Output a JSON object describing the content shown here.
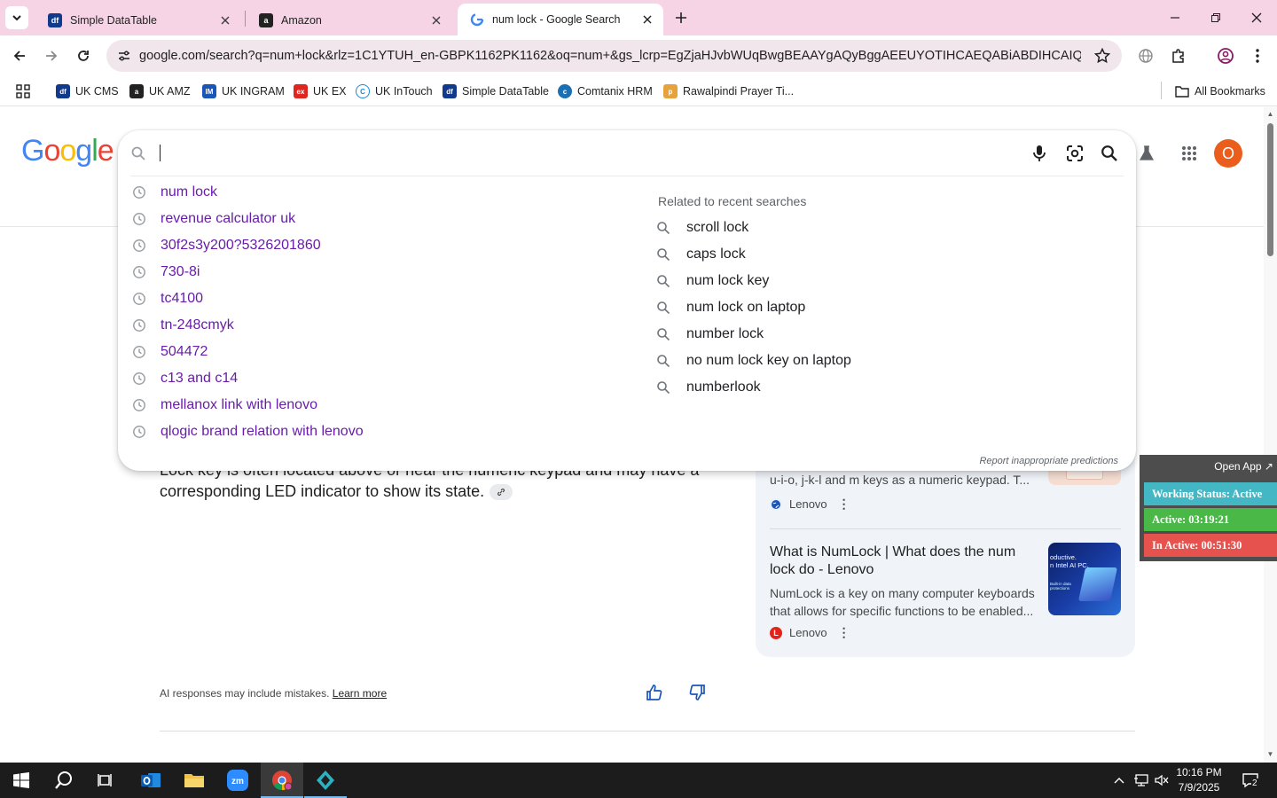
{
  "browser": {
    "tabs": [
      {
        "label": "Simple DataTable",
        "favicon": "df"
      },
      {
        "label": "Amazon",
        "favicon": "a"
      },
      {
        "label": "num lock - Google Search",
        "favicon": "G"
      }
    ],
    "url": "google.com/search?q=num+lock&rlz=1C1YTUH_en-GBPK1162PK1162&oq=num+&gs_lcrp=EgZjaHJvbWUqBwgBEAAYgAQyBggAEEUYOTIHCAEQABiABDIHCAIQABiABDIH...",
    "bookmarks": [
      {
        "label": "UK CMS",
        "icon": "df"
      },
      {
        "label": "UK AMZ",
        "icon": "a"
      },
      {
        "label": "UK INGRAM",
        "icon": "IM"
      },
      {
        "label": "UK EX",
        "icon": "ex"
      },
      {
        "label": "UK InTouch",
        "icon": "C"
      },
      {
        "label": "Simple DataTable",
        "icon": "df"
      },
      {
        "label": "Comtanix HRM",
        "icon": "c"
      },
      {
        "label": "Rawalpindi Prayer Ti...",
        "icon": "p"
      }
    ],
    "all_bookmarks": "All Bookmarks"
  },
  "google": {
    "logo": "Google",
    "avatar_letter": "O",
    "search": {
      "value": "",
      "history": [
        "num lock",
        "revenue calculator uk",
        "30f2s3y200?5326201860",
        "730-8i",
        "tc4100",
        "tn-248cmyk",
        "504472",
        "c13 and c14",
        "mellanox link with lenovo",
        "qlogic brand relation with lenovo"
      ],
      "related_title": "Related to recent searches",
      "related": [
        "scroll lock",
        "caps lock",
        "num lock key",
        "num lock on laptop",
        "number lock",
        "no num lock key on laptop",
        "numberlook"
      ],
      "report": "Report inappropriate predictions"
    },
    "ai_overview": {
      "text_line1": "Lock key is often located above or near the numeric keypad and may have a",
      "text_line2": "corresponding LED indicator to show its state.",
      "footer_text": "AI responses may include mistakes.",
      "learn_more": "Learn more"
    },
    "sources": [
      {
        "snippet": "u-i-o, j-k-l and m keys as a numeric keypad. T...",
        "site": "Lenovo"
      },
      {
        "title": "What is NumLock | What does the num lock do - Lenovo",
        "snippet": "NumLock is a key on many computer keyboards that allows for specific functions to be enabled...",
        "site": "Lenovo",
        "thumb_text": "oductive.\nn Intel AI PC.",
        "thumb_small": "Built-in data protections"
      }
    ]
  },
  "tracker": {
    "open_app": "Open App ↗",
    "working_status": "Working Status: Active",
    "active": "Active: 03:19:21",
    "inactive": "In Active: 00:51:30"
  },
  "taskbar": {
    "time": "10:16 PM",
    "date": "7/9/2025",
    "notifications": "2"
  },
  "colors": {
    "tab_strip": "#f6d4e6",
    "visited_link": "#681da8",
    "avatar": "#ea5d1c",
    "tracker_status": "#44b7c4",
    "tracker_active": "#49b846",
    "tracker_inactive": "#e6534f"
  }
}
